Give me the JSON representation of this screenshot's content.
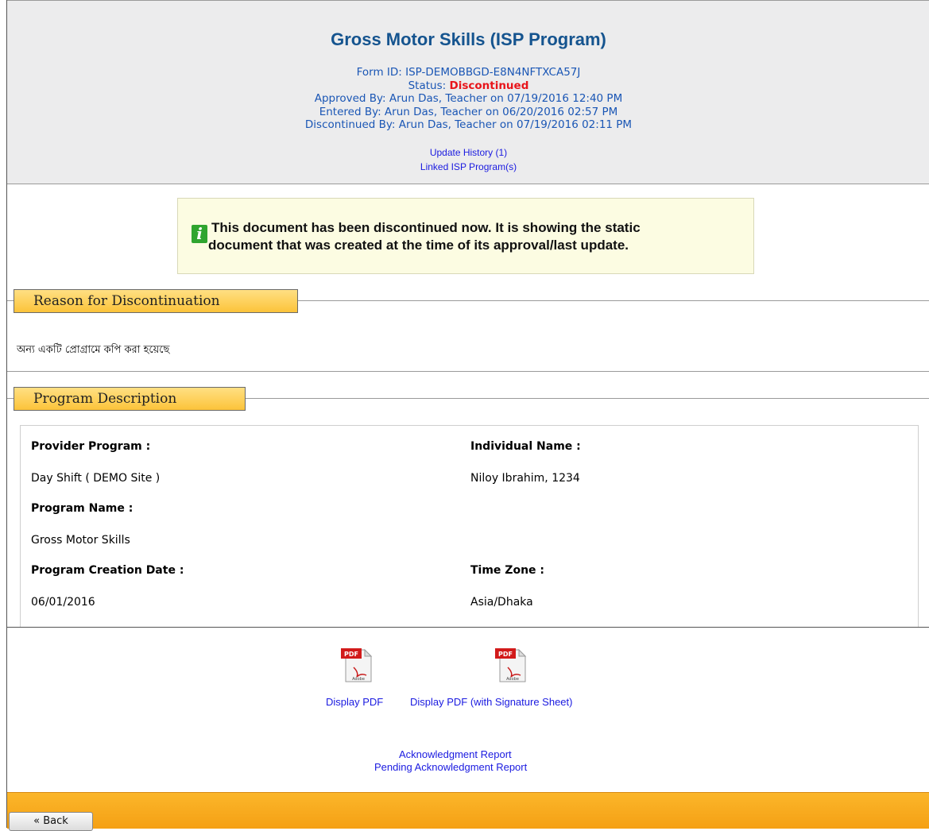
{
  "header": {
    "title": "Gross Motor Skills (ISP Program)",
    "form_id": "Form ID: ISP-DEMOBBGD-E8N4NFTXCA57J",
    "status_label": "Status:",
    "status_value": "Discontinued",
    "approved_by": "Approved By: Arun Das, Teacher on 07/19/2016 12:40 PM",
    "entered_by": "Entered By: Arun Das, Teacher  on 06/20/2016 02:57 PM",
    "discontinued_by": "Discontinued By: Arun Das, Teacher on 07/19/2016 02:11 PM",
    "update_history": "Update History  (1)",
    "linked_programs": "Linked ISP Program(s)"
  },
  "notice": {
    "icon": "info-icon",
    "line1": "This document has been discontinued now. It is showing the static",
    "line2": "document that was created at the time of its approval/last update."
  },
  "reason": {
    "legend": "Reason for Discontinuation",
    "text": "অন্য একটি প্রোগ্রামে কপি করা হয়েছে"
  },
  "description": {
    "legend": "Program Description",
    "provider_program_label": "Provider Program :",
    "provider_program_value": "Day Shift ( DEMO Site )",
    "individual_name_label": "Individual Name :",
    "individual_name_value": "Niloy Ibrahim, 1234",
    "program_name_label": "Program Name :",
    "program_name_value": "Gross Motor Skills",
    "creation_date_label": "Program Creation Date :",
    "creation_date_value": "06/01/2016",
    "time_zone_label": "Time Zone :",
    "time_zone_value": "Asia/Dhaka"
  },
  "actions": {
    "display_pdf": "Display PDF",
    "display_pdf_signature": "Display PDF (with Signature Sheet)",
    "acknowledgment_report": "Acknowledgment Report",
    "pending_acknowledgment_report": "Pending Acknowledgment Report",
    "pdf_icon_text": "PDF",
    "pdf_icon_subtext": "Adobe"
  },
  "footer": {
    "back_label": "« Back"
  },
  "colors": {
    "title": "#15548f",
    "meta": "#1a56b5",
    "status": "#e8151b",
    "link": "#1a1ae0",
    "footer": "#f5a014"
  }
}
